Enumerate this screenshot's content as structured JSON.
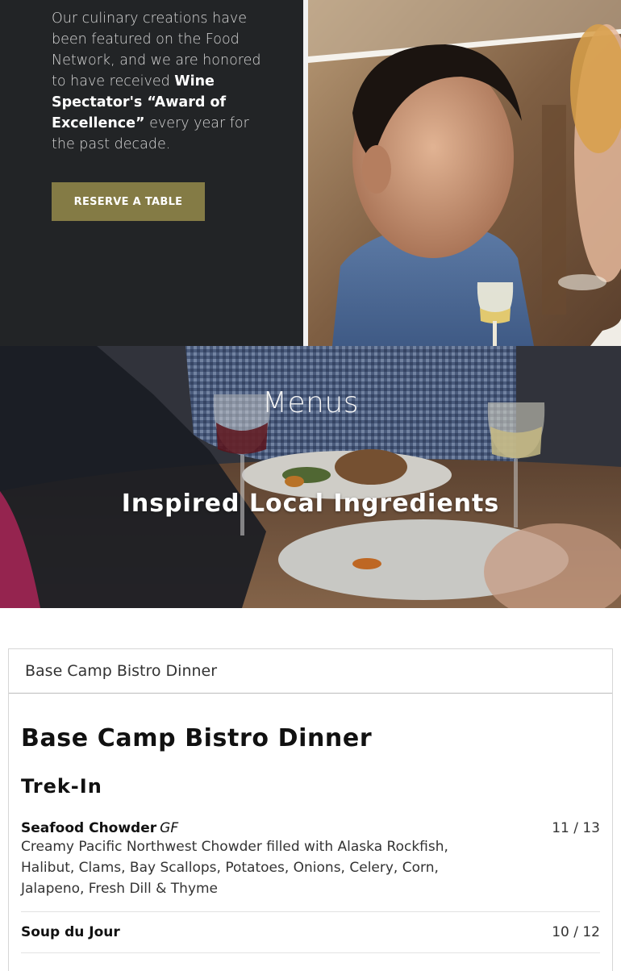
{
  "about": {
    "text_1": "Our culinary creations have been featured on the Food Network, and we are honored to have received ",
    "text_bold": "Wine Spectator's “Award of Excellence”",
    "text_2": " every year for the past decade.",
    "reserve_label": "RESERVE A TABLE"
  },
  "banner": {
    "title": "Menus",
    "subtitle": "Inspired Local Ingredients"
  },
  "menu": {
    "tab_label": "Base Camp Bistro Dinner",
    "heading": "Base Camp Bistro Dinner",
    "section": "Trek-In",
    "items": [
      {
        "name": "Seafood Chowder",
        "tag": "GF",
        "price": "11 / 13",
        "description": "Creamy Pacific Northwest Chowder filled with Alaska Rockfish, Halibut, Clams, Bay Scallops, Potatoes, Onions, Celery, Corn, Jalapeno, Fresh Dill & Thyme"
      },
      {
        "name": "Soup du Jour",
        "tag": "",
        "price": "10 / 12",
        "description": ""
      }
    ]
  },
  "colors": {
    "dark_panel": "#222426",
    "accent_button": "#847b45"
  }
}
